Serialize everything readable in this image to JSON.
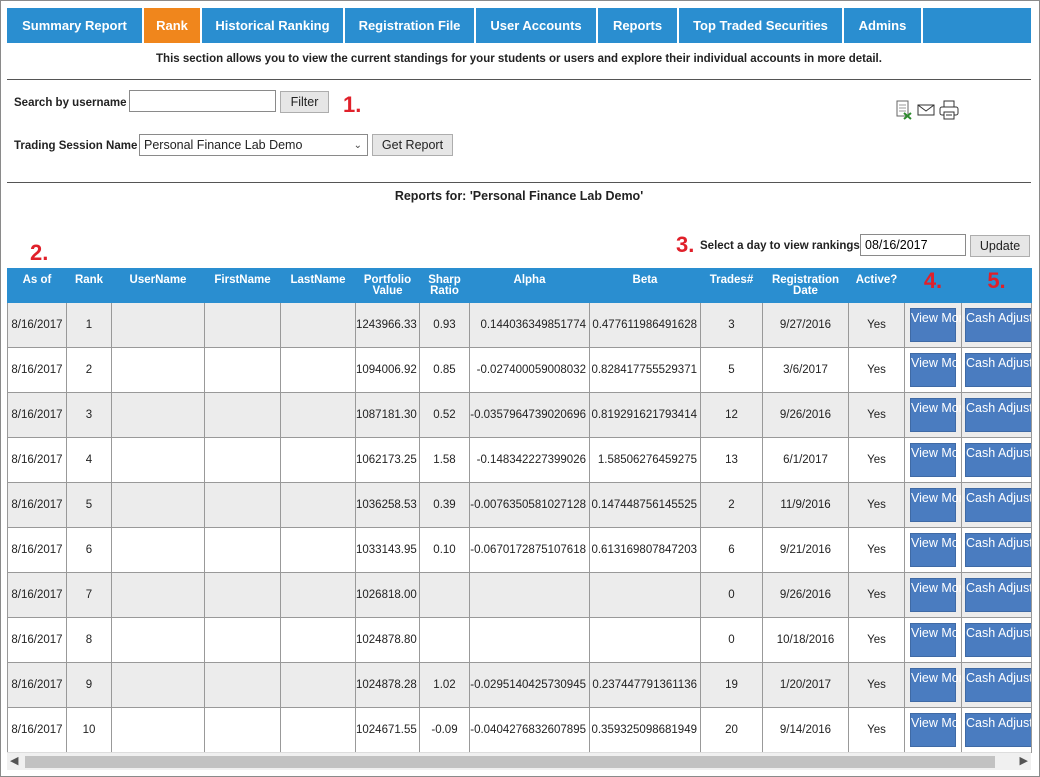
{
  "nav": [
    {
      "label": "Summary Report",
      "width": 137
    },
    {
      "label": "Rank",
      "width": 58,
      "active": true
    },
    {
      "label": "Historical Ranking",
      "width": 143
    },
    {
      "label": "Registration File",
      "width": 131
    },
    {
      "label": "User Accounts",
      "width": 122
    },
    {
      "label": "Reports",
      "width": 81
    },
    {
      "label": "Top Traded Securities",
      "width": 165
    },
    {
      "label": "Admins",
      "width": 79
    }
  ],
  "intro": "This section allows you to view the current standings for your students or users and explore their individual accounts in more detail.",
  "search": {
    "label": "Search by username",
    "value": "",
    "filter_label": "Filter"
  },
  "session": {
    "label": "Trading Session Name",
    "selected": "Personal Finance Lab Demo",
    "get_report_label": "Get Report"
  },
  "markers": {
    "m1": "1.",
    "m2": "2.",
    "m3": "3.",
    "m4": "4.",
    "m5": "5."
  },
  "icons": [
    "excel-export-icon",
    "email-icon",
    "print-icon"
  ],
  "reports_for": "Reports for: 'Personal Finance Lab Demo'",
  "date_select": {
    "label": "Select a day to view rankings",
    "value": "08/16/2017",
    "update_label": "Update"
  },
  "table": {
    "headers": [
      "As of",
      "Rank",
      "UserName",
      "FirstName",
      "LastName",
      "Portfolio Value",
      "Sharp Ratio",
      "Alpha",
      "Beta",
      "Trades#",
      "Registration Date",
      "Active?",
      "",
      ""
    ],
    "view_more_label": "View More",
    "cash_label": "Cash Adjustment",
    "rows": [
      {
        "as_of": "8/16/2017",
        "rank": "1",
        "username": "",
        "firstname": "",
        "lastname": "",
        "portfolio": "1243966.33",
        "sharp": "0.93",
        "alpha": "0.144036349851774",
        "beta": "0.477611986491628",
        "trades": "3",
        "reg_date": "9/27/2016",
        "active": "Yes"
      },
      {
        "as_of": "8/16/2017",
        "rank": "2",
        "username": "",
        "firstname": "",
        "lastname": "",
        "portfolio": "1094006.92",
        "sharp": "0.85",
        "alpha": "-0.027400059008032",
        "beta": "0.828417755529371",
        "trades": "5",
        "reg_date": "3/6/2017",
        "active": "Yes"
      },
      {
        "as_of": "8/16/2017",
        "rank": "3",
        "username": "",
        "firstname": "",
        "lastname": "",
        "portfolio": "1087181.30",
        "sharp": "0.52",
        "alpha": "-0.0357964739020696",
        "beta": "0.819291621793414",
        "trades": "12",
        "reg_date": "9/26/2016",
        "active": "Yes"
      },
      {
        "as_of": "8/16/2017",
        "rank": "4",
        "username": "",
        "firstname": "",
        "lastname": "",
        "portfolio": "1062173.25",
        "sharp": "1.58",
        "alpha": "-0.148342227399026",
        "beta": "1.58506276459275",
        "trades": "13",
        "reg_date": "6/1/2017",
        "active": "Yes"
      },
      {
        "as_of": "8/16/2017",
        "rank": "5",
        "username": "",
        "firstname": "",
        "lastname": "",
        "portfolio": "1036258.53",
        "sharp": "0.39",
        "alpha": "-0.0076350581027128",
        "beta": "0.147448756145525",
        "trades": "2",
        "reg_date": "11/9/2016",
        "active": "Yes"
      },
      {
        "as_of": "8/16/2017",
        "rank": "6",
        "username": "",
        "firstname": "",
        "lastname": "",
        "portfolio": "1033143.95",
        "sharp": "0.10",
        "alpha": "-0.0670172875107618",
        "beta": "0.613169807847203",
        "trades": "6",
        "reg_date": "9/21/2016",
        "active": "Yes"
      },
      {
        "as_of": "8/16/2017",
        "rank": "7",
        "username": "",
        "firstname": "",
        "lastname": "",
        "portfolio": "1026818.00",
        "sharp": "",
        "alpha": "",
        "beta": "",
        "trades": "0",
        "reg_date": "9/26/2016",
        "active": "Yes"
      },
      {
        "as_of": "8/16/2017",
        "rank": "8",
        "username": "",
        "firstname": "",
        "lastname": "",
        "portfolio": "1024878.80",
        "sharp": "",
        "alpha": "",
        "beta": "",
        "trades": "0",
        "reg_date": "10/18/2016",
        "active": "Yes"
      },
      {
        "as_of": "8/16/2017",
        "rank": "9",
        "username": "",
        "firstname": "",
        "lastname": "",
        "portfolio": "1024878.28",
        "sharp": "1.02",
        "alpha": "-0.0295140425730945",
        "beta": "0.237447791361136",
        "trades": "19",
        "reg_date": "1/20/2017",
        "active": "Yes"
      },
      {
        "as_of": "8/16/2017",
        "rank": "10",
        "username": "",
        "firstname": "",
        "lastname": "",
        "portfolio": "1024671.55",
        "sharp": "-0.09",
        "alpha": "-0.0404276832607895",
        "beta": "0.359325098681949",
        "trades": "20",
        "reg_date": "9/14/2016",
        "active": "Yes"
      }
    ]
  }
}
